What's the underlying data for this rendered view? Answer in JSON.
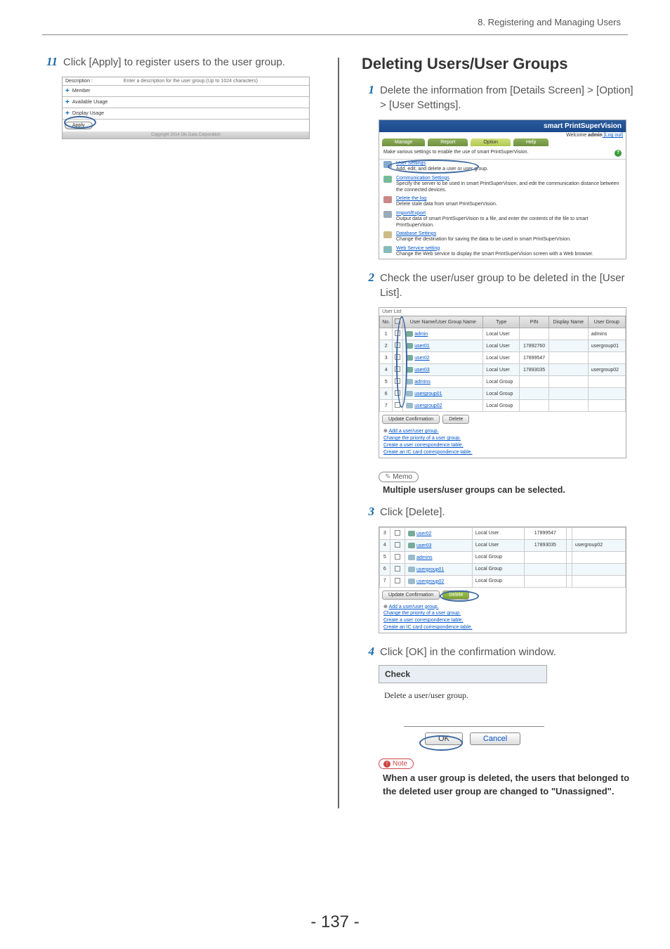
{
  "header": {
    "section": "8. Registering and Managing Users"
  },
  "left": {
    "step11_num": "11",
    "step11_text": "Click [Apply] to register users to the user group.",
    "ss1": {
      "desc_label": "Description :",
      "desc_hint": "Enter a description for the user group.(Up to 1024 characters)",
      "rows": [
        "Member",
        "Available Usage",
        "Display Usage"
      ],
      "apply": "Apply",
      "copyright": "Copyright 2014 Oki Data Corporation"
    }
  },
  "right": {
    "heading": "Deleting Users/User Groups",
    "step1_num": "1",
    "step1_text": "Delete the information from [Details Screen] > [Option] > [User Settings].",
    "step2_num": "2",
    "step2_text": "Check the user/user group to be deleted in the [User List].",
    "step3_num": "3",
    "step3_text": "Click [Delete].",
    "step4_num": "4",
    "step4_text": "Click [OK] in the confirmation window.",
    "memo_label": "Memo",
    "memo_text": "Multiple users/user groups can be selected.",
    "note_label": "Note",
    "note_text": "When a user group is deleted, the users that belonged to the deleted user group are changed to \"Unassigned\".",
    "banner": {
      "title": "smart PrintSuperVision",
      "welcome_prefix": "Welcome ",
      "welcome_user": "admin",
      "logout": " [Log out]",
      "tabs": [
        "Manage",
        "Report",
        "Option",
        "Help"
      ],
      "caption": "Make various settings to enable the use of smart PrintSuperVision.",
      "items": [
        {
          "title": "User Settings",
          "desc": "Add, edit, and delete a user or user group."
        },
        {
          "title": "Communication Settings",
          "desc": "Specify the server to be used in smart PrintSuperVision, and edit the communication distance between the connected devices."
        },
        {
          "title": "Delete the log",
          "desc": "Delete stale data from smart PrintSuperVision."
        },
        {
          "title": "Import/Export",
          "desc": "Output data of smart PrintSuperVision to a file, and enter the contents of the file to smart PrintSuperVision."
        },
        {
          "title": "Database Settings",
          "desc": "Change the destination for saving the data to be used in smart PrintSuperVision."
        },
        {
          "title": "Web Service setting",
          "desc": "Change the Web service to display the smart PrintSuperVision screen with a Web browser."
        }
      ]
    },
    "userlist": {
      "header": "User List",
      "cols": [
        "No.",
        "",
        "User Name/User Group Name",
        "Type",
        "PIN",
        "Display Name",
        "User Group"
      ],
      "rows": [
        {
          "no": "1",
          "name": "admin",
          "type": "Local User",
          "pin": "",
          "disp": "",
          "grp": "admins",
          "alt": false,
          "g": false
        },
        {
          "no": "2",
          "name": "user01",
          "type": "Local User",
          "pin": "17892760",
          "disp": "",
          "grp": "usergroup01",
          "alt": true,
          "g": false
        },
        {
          "no": "3",
          "name": "user02",
          "type": "Local User",
          "pin": "17899547",
          "disp": "",
          "grp": "",
          "alt": false,
          "g": false
        },
        {
          "no": "4",
          "name": "user03",
          "type": "Local User",
          "pin": "17893035",
          "disp": "",
          "grp": "usergroup02",
          "alt": true,
          "g": false
        },
        {
          "no": "5",
          "name": "admins",
          "type": "Local Group",
          "pin": "",
          "disp": "",
          "grp": "",
          "alt": false,
          "g": true
        },
        {
          "no": "6",
          "name": "usergroup01",
          "type": "Local Group",
          "pin": "",
          "disp": "",
          "grp": "",
          "alt": true,
          "g": true
        },
        {
          "no": "7",
          "name": "usergroup02",
          "type": "Local Group",
          "pin": "",
          "disp": "",
          "grp": "",
          "alt": false,
          "g": true
        }
      ],
      "btn_update": "Update Confirmation",
      "btn_delete": "Delete",
      "links": [
        "Add a user/user group.",
        "Change the priority of a user group.",
        "Create a user correspondence table.",
        "Create an IC card correspondence table."
      ]
    },
    "userlist2_rows": [
      {
        "no": "3",
        "name": "user02",
        "type": "Local User",
        "pin": "17899547",
        "disp": "",
        "grp": "",
        "alt": false,
        "g": false
      },
      {
        "no": "4",
        "name": "user03",
        "type": "Local User",
        "pin": "17893035",
        "disp": "",
        "grp": "usergroup02",
        "alt": true,
        "g": false
      },
      {
        "no": "5",
        "name": "admins",
        "type": "Local Group",
        "pin": "",
        "disp": "",
        "grp": "",
        "alt": false,
        "g": true
      },
      {
        "no": "6",
        "name": "usergroup01",
        "type": "Local Group",
        "pin": "",
        "disp": "",
        "grp": "",
        "alt": true,
        "g": true
      },
      {
        "no": "7",
        "name": "usergroup02",
        "type": "Local Group",
        "pin": "",
        "disp": "",
        "grp": "",
        "alt": false,
        "g": true
      }
    ],
    "dialog": {
      "title": "Check",
      "body": "Delete a user/user group.",
      "ok": "OK",
      "cancel": "Cancel"
    }
  },
  "page_number": "- 137 -"
}
